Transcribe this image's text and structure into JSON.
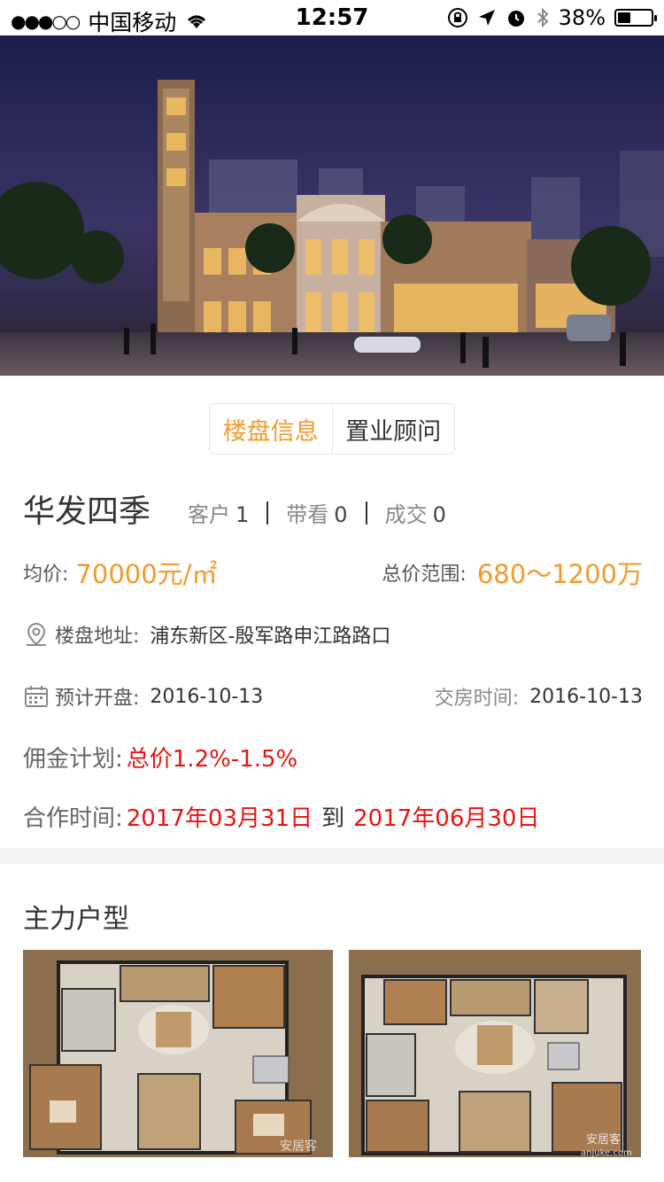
{
  "status_bar": {
    "carrier": "中国移动",
    "time": "12:57",
    "battery": "38%",
    "battery_level": 0.38
  },
  "tabs": [
    {
      "label": "楼盘信息",
      "active": true
    },
    {
      "label": "置业顾问",
      "active": false
    }
  ],
  "project": {
    "name": "华发四季",
    "stats": [
      {
        "label": "客户",
        "value": "1"
      },
      {
        "label": "带看",
        "value": "0"
      },
      {
        "label": "成交",
        "value": "0"
      }
    ]
  },
  "price": {
    "avg_label": "均价:",
    "avg_value": "70000元/㎡",
    "range_label": "总价范围:",
    "range_value": "680～1200万"
  },
  "address": {
    "label": "楼盘地址:",
    "value": "浦东新区-殷军路申江路路口"
  },
  "dates": {
    "open_label": "预计开盘:",
    "open_value": "2016-10-13",
    "delivery_label": "交房时间:",
    "delivery_value": "2016-10-13"
  },
  "commission": {
    "label": "佣金计划:",
    "value": "总价1.2%-1.5%"
  },
  "cooperation": {
    "label": "合作时间:",
    "start": "2017年03月31日",
    "connector": "到",
    "end": "2017年06月30日"
  },
  "main_floorplans": {
    "title": "主力户型",
    "watermark": "安居客",
    "watermark_url": "anjuke.com"
  },
  "colors": {
    "accent": "#f39a2b",
    "highlight": "#e8140e"
  }
}
